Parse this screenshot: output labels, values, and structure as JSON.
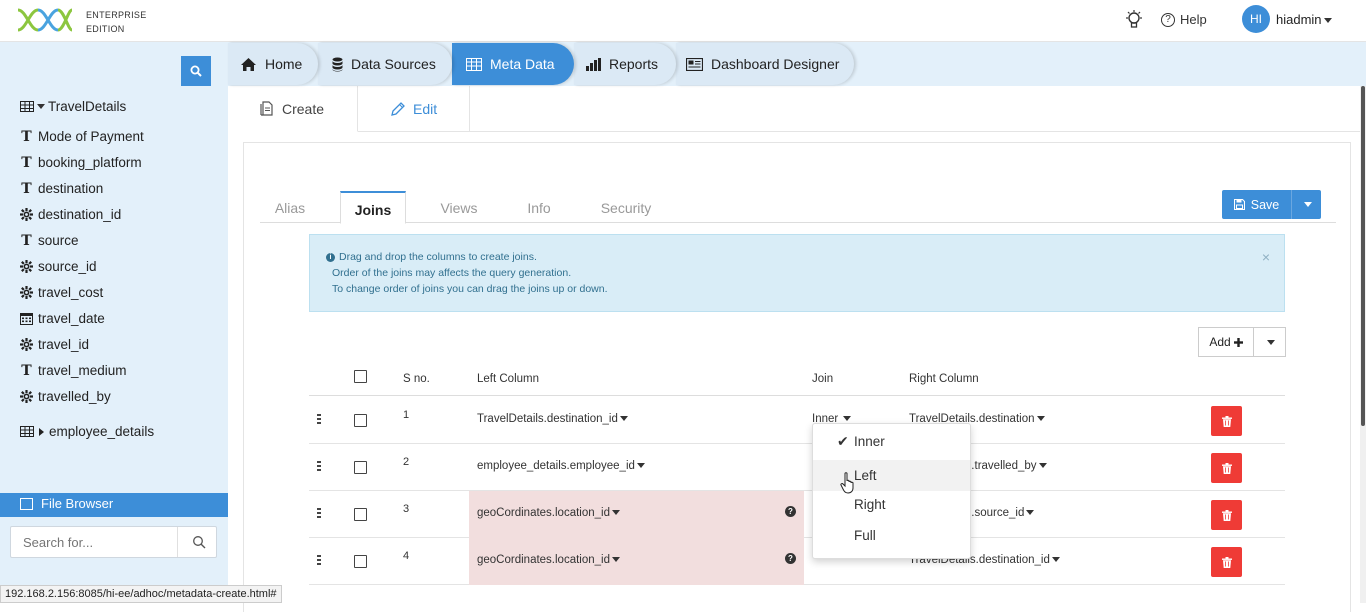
{
  "header": {
    "edition_line1": "ENTERPRISE",
    "edition_line2": "EDITION",
    "help_label": "Help",
    "avatar_initials": "HI",
    "username": "hiadmin"
  },
  "sidebar": {
    "table_name": "TravelDetails",
    "columns": [
      {
        "label": "Mode of Payment",
        "icon": "text-icon"
      },
      {
        "label": "booking_platform",
        "icon": "text-icon"
      },
      {
        "label": "destination",
        "icon": "text-icon"
      },
      {
        "label": "destination_id",
        "icon": "gear-icon"
      },
      {
        "label": "source",
        "icon": "text-icon"
      },
      {
        "label": "source_id",
        "icon": "gear-icon"
      },
      {
        "label": "travel_cost",
        "icon": "gear-icon"
      },
      {
        "label": "travel_date",
        "icon": "calendar-icon"
      },
      {
        "label": "travel_id",
        "icon": "gear-icon"
      },
      {
        "label": "travel_medium",
        "icon": "text-icon"
      },
      {
        "label": "travelled_by",
        "icon": "gear-icon"
      }
    ],
    "table2_name": "employee_details",
    "file_browser_label": "File Browser",
    "search_placeholder": "Search for..."
  },
  "nav": {
    "tabs": [
      {
        "label": "Home"
      },
      {
        "label": "Data Sources"
      },
      {
        "label": "Meta Data"
      },
      {
        "label": "Reports"
      },
      {
        "label": "Dashboard Designer"
      }
    ]
  },
  "subtabs": {
    "create": "Create",
    "edit": "Edit"
  },
  "inner_tabs": [
    "Alias",
    "Joins",
    "Views",
    "Info",
    "Security"
  ],
  "save_label": "Save",
  "alert": {
    "line1": "Drag and drop the columns to create joins.",
    "line2": "Order of the joins may affects the query generation.",
    "line3": "To change order of joins you can drag the joins up or down.",
    "close": "×"
  },
  "add_label": "Add",
  "joins_table": {
    "headers": {
      "sno": "S no.",
      "left": "Left Column",
      "join": "Join",
      "right": "Right Column"
    },
    "rows": [
      {
        "sno": "1",
        "left": "TravelDetails.destination_id",
        "join": "Inner",
        "right": "TravelDetails.destination"
      },
      {
        "sno": "2",
        "left": "employee_details.employee_id",
        "join": "",
        "right": "ls.travelled_by"
      },
      {
        "sno": "3",
        "left": "geoCordinates.location_id",
        "join": "",
        "right": "ls.source_id"
      },
      {
        "sno": "4",
        "left": "geoCordinates.location_id",
        "join": "",
        "right": "TravelDetails.destination_id"
      }
    ]
  },
  "join_dropdown": {
    "options": [
      "Inner",
      "Left",
      "Right",
      "Full"
    ],
    "selected": "Inner",
    "hovered": "Left"
  },
  "status_url": "192.168.2.156:8085/hi-ee/adhoc/metadata-create.html#",
  "colors": {
    "accent": "#3d8ed8",
    "sidebar_bg": "#e3f0fa",
    "danger": "#ef3b36",
    "error_bg": "#f2dede"
  }
}
